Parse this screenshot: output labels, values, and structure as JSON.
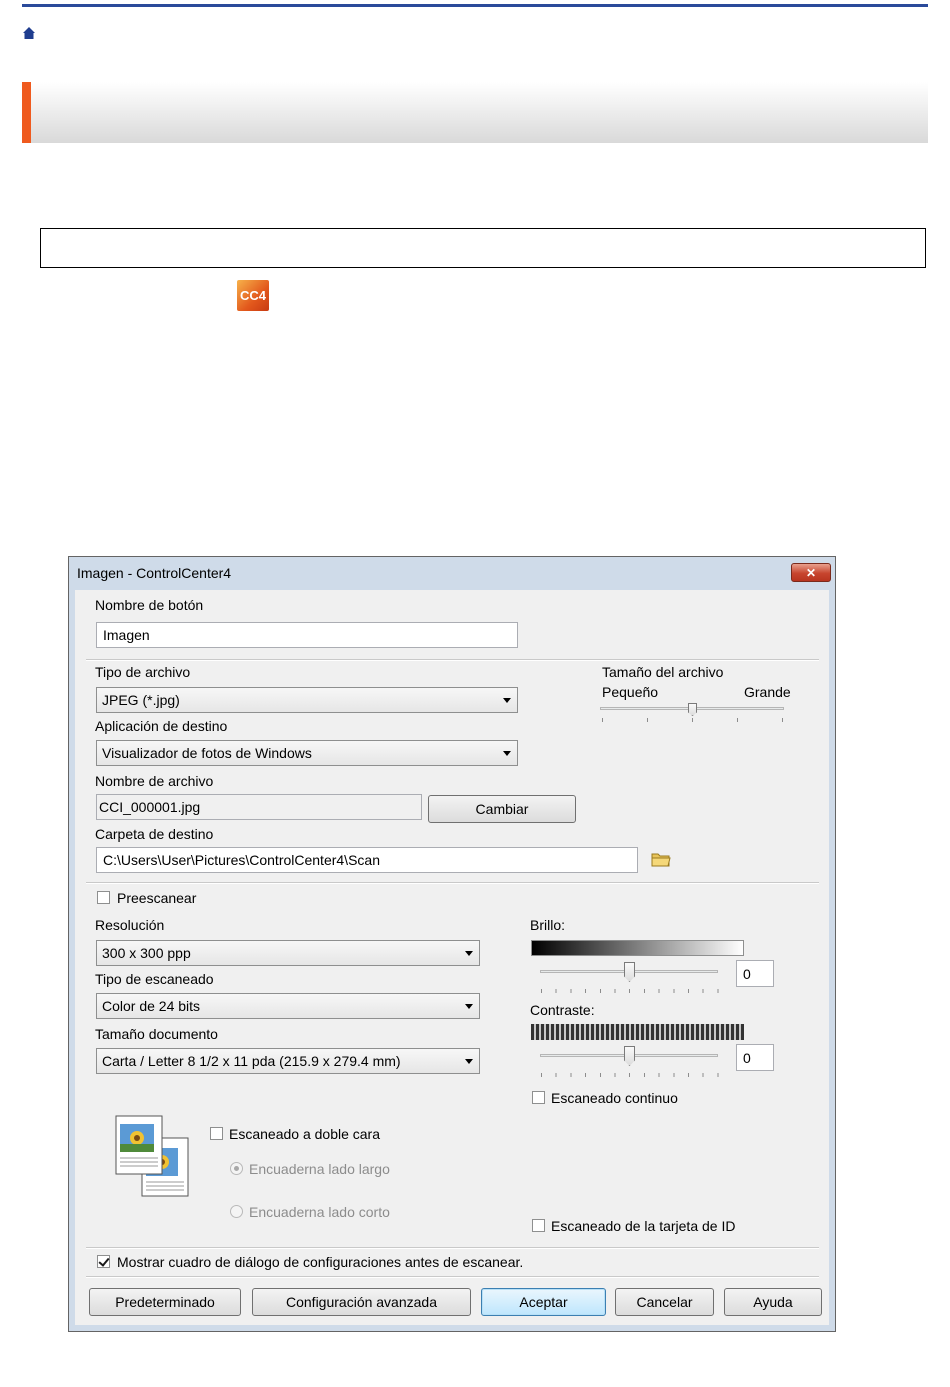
{
  "page": {
    "home_icon": "home-icon",
    "app_icon": "cc4-icon",
    "app_icon_label": "CC4"
  },
  "dialog": {
    "title": "Imagen - ControlCenter4",
    "close_label": "✕",
    "button_name": {
      "label": "Nombre de botón",
      "value": "Imagen"
    },
    "file_type": {
      "label": "Tipo de archivo",
      "value": "JPEG (*.jpg)"
    },
    "file_size": {
      "label": "Tamaño del archivo",
      "min_label": "Pequeño",
      "max_label": "Grande",
      "level": 0.5
    },
    "target_app": {
      "label": "Aplicación de destino",
      "value": "Visualizador de fotos de Windows"
    },
    "file_name": {
      "label": "Nombre de archivo",
      "value": "CCI_000001.jpg",
      "change_label": "Cambiar"
    },
    "dest_folder": {
      "label": "Carpeta de destino",
      "value": "C:\\Users\\User\\Pictures\\ControlCenter4\\Scan",
      "icon": "folder-icon"
    },
    "prescan": {
      "label": "Preescanear",
      "checked": false
    },
    "resolution": {
      "label": "Resolución",
      "value": "300 x 300 ppp"
    },
    "scan_type": {
      "label": "Tipo de escaneado",
      "value": "Color de 24 bits"
    },
    "doc_size": {
      "label": "Tamaño documento",
      "value": "Carta / Letter 8 1/2 x 11 pda (215.9 x 279.4 mm)"
    },
    "brightness": {
      "label": "Brillo:",
      "value": "0"
    },
    "contrast": {
      "label": "Contraste:",
      "value": "0"
    },
    "continuous_scan": {
      "label": "Escaneado continuo",
      "checked": false
    },
    "duplex": {
      "label": "Escaneado a doble cara",
      "checked": false,
      "long_edge": "Encuaderna lado largo",
      "short_edge": "Encuaderna lado corto"
    },
    "id_card_scan": {
      "label": "Escaneado de la tarjeta de ID",
      "checked": false
    },
    "show_dialog": {
      "label": "Mostrar cuadro de diálogo de configuraciones antes de escanear.",
      "checked": true
    },
    "buttons": {
      "default": "Predeterminado",
      "advanced": "Configuración avanzada",
      "ok": "Aceptar",
      "cancel": "Cancelar",
      "help": "Ayuda"
    }
  }
}
